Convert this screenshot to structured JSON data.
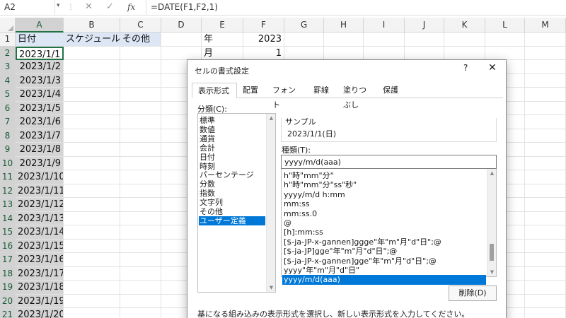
{
  "formula_bar": {
    "name_box": "A2",
    "cancel_icon": "✕",
    "enter_icon": "✓",
    "fx_label": "fx",
    "formula": "=DATE(F1,F2,1)"
  },
  "sheet": {
    "columns": [
      "A",
      "B",
      "C",
      "D",
      "E",
      "F",
      "G",
      "H",
      "I",
      "J",
      "K",
      "L",
      "M"
    ],
    "rows": [
      {
        "n": "1",
        "a": "日付",
        "b": "スケジュール",
        "c": "その他",
        "e": "年",
        "f": "2023"
      },
      {
        "n": "2",
        "a": "2023/1/1",
        "e": "月",
        "f": "1"
      },
      {
        "n": "3",
        "a": "2023/1/2"
      },
      {
        "n": "4",
        "a": "2023/1/3"
      },
      {
        "n": "5",
        "a": "2023/1/4"
      },
      {
        "n": "6",
        "a": "2023/1/5"
      },
      {
        "n": "7",
        "a": "2023/1/6"
      },
      {
        "n": "8",
        "a": "2023/1/7"
      },
      {
        "n": "9",
        "a": "2023/1/8"
      },
      {
        "n": "10",
        "a": "2023/1/9"
      },
      {
        "n": "11",
        "a": "2023/1/10"
      },
      {
        "n": "12",
        "a": "2023/1/11"
      },
      {
        "n": "13",
        "a": "2023/1/12"
      },
      {
        "n": "14",
        "a": "2023/1/13"
      },
      {
        "n": "15",
        "a": "2023/1/14"
      },
      {
        "n": "16",
        "a": "2023/1/15"
      },
      {
        "n": "17",
        "a": "2023/1/16"
      },
      {
        "n": "18",
        "a": "2023/1/17"
      },
      {
        "n": "19",
        "a": "2023/1/18"
      },
      {
        "n": "20",
        "a": "2023/1/19"
      },
      {
        "n": "21",
        "a": "2023/1/20"
      }
    ]
  },
  "dialog": {
    "title": "セルの書式設定",
    "help": "?",
    "close": "✕",
    "tabs": [
      "表示形式",
      "配置",
      "フォント",
      "罫線",
      "塗りつぶし",
      "保護"
    ],
    "active_tab": 0,
    "category_label": "分類(C):",
    "categories": [
      "標準",
      "数値",
      "通貨",
      "会計",
      "日付",
      "時刻",
      "パーセンテージ",
      "分数",
      "指数",
      "文字列",
      "その他",
      "ユーザー定義"
    ],
    "selected_category": 11,
    "sample_label": "サンプル",
    "sample_value": "2023/1/1(日)",
    "type_label": "種類(T):",
    "type_value": "yyyy/m/d(aaa)",
    "formats": [
      "h\"時\"mm\"分\"",
      "h\"時\"mm\"分\"ss\"秒\"",
      "yyyy/m/d h:mm",
      "mm:ss",
      "mm:ss.0",
      "@",
      "[h]:mm:ss",
      "[$-ja-JP-x-gannen]ggge\"年\"m\"月\"d\"日\";@",
      "[$-ja-JP]gge\"年\"m\"月\"d\"日\";@",
      "[$-ja-JP-x-gannen]gge\"年\"m\"月\"d\"日\";@",
      "yyyy\"年\"m\"月\"d\"日\"",
      "yyyy/m/d(aaa)"
    ],
    "selected_format": 11,
    "delete_label": "削除(D)",
    "hint": "基になる組み込みの表示形式を選択し、新しい表示形式を入力してください。"
  }
}
